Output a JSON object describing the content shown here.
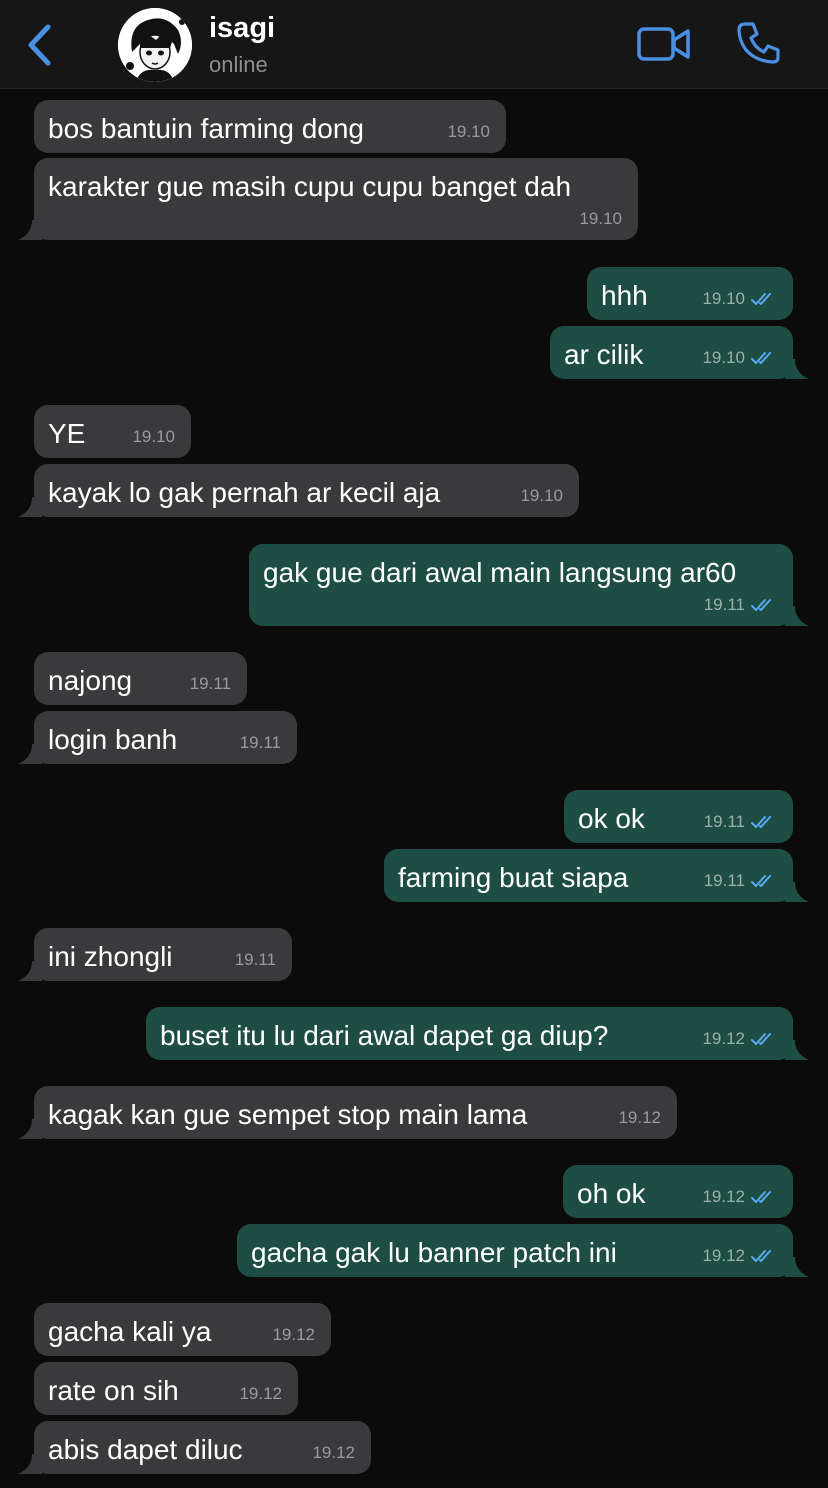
{
  "header": {
    "contact_name": "isagi",
    "status": "online",
    "back_icon": "chevron-left-icon",
    "video_icon": "video-camera-icon",
    "call_icon": "phone-icon"
  },
  "colors": {
    "accent": "#4a90e2",
    "incoming_bubble": "#3a3a3c",
    "outgoing_bubble": "#1e4d44",
    "read_ticks": "#5aa9f0"
  },
  "messages": [
    {
      "dir": "in",
      "text": "bos bantuin farming dong",
      "time": "19.10"
    },
    {
      "dir": "in",
      "text": "karakter gue masih cupu cupu banget dah",
      "time": "19.10"
    },
    {
      "dir": "out",
      "text": "hhh",
      "time": "19.10",
      "read": true
    },
    {
      "dir": "out",
      "text": "ar cilik",
      "time": "19.10",
      "read": true
    },
    {
      "dir": "in",
      "text": "YE",
      "time": "19.10"
    },
    {
      "dir": "in",
      "text": "kayak lo gak pernah ar kecil aja",
      "time": "19.10"
    },
    {
      "dir": "out",
      "text": "gak gue dari awal main langsung ar60",
      "time": "19.11",
      "read": true
    },
    {
      "dir": "in",
      "text": "najong",
      "time": "19.11"
    },
    {
      "dir": "in",
      "text": "login banh",
      "time": "19.11"
    },
    {
      "dir": "out",
      "text": "ok ok",
      "time": "19.11",
      "read": true
    },
    {
      "dir": "out",
      "text": "farming buat siapa",
      "time": "19.11",
      "read": true
    },
    {
      "dir": "in",
      "text": "ini zhongli",
      "time": "19.11"
    },
    {
      "dir": "out",
      "text": "buset itu lu dari awal dapet ga diup?",
      "time": "19.12",
      "read": true
    },
    {
      "dir": "in",
      "text": "kagak kan gue sempet stop main lama",
      "time": "19.12"
    },
    {
      "dir": "out",
      "text": "oh ok",
      "time": "19.12",
      "read": true
    },
    {
      "dir": "out",
      "text": "gacha gak lu banner patch ini",
      "time": "19.12",
      "read": true
    },
    {
      "dir": "in",
      "text": "gacha kali ya",
      "time": "19.12"
    },
    {
      "dir": "in",
      "text": "rate on sih",
      "time": "19.12"
    },
    {
      "dir": "in",
      "text": "abis dapet diluc",
      "time": "19.12"
    }
  ]
}
